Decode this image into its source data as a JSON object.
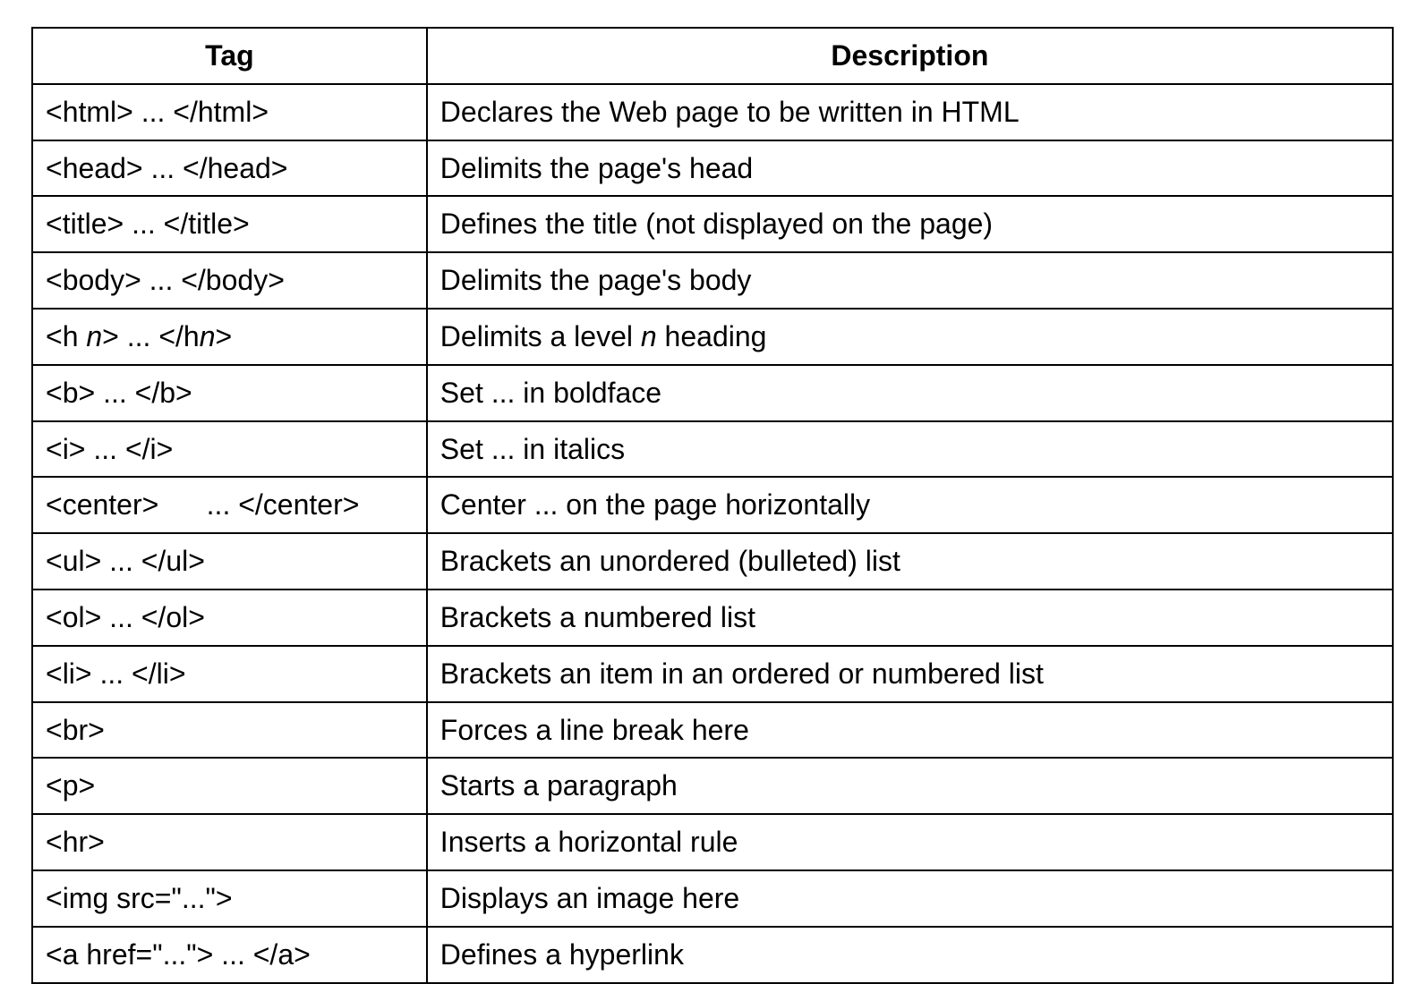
{
  "chart_data": {
    "type": "table",
    "columns": [
      "Tag",
      "Description"
    ],
    "rows": [
      {
        "tag": "<html> ... </html>",
        "desc": "Declares the Web page to be written in HTML"
      },
      {
        "tag": "<head> ... </head>",
        "desc": "Delimits the page's head"
      },
      {
        "tag": "<title> ... </title>",
        "desc": "Defines the title (not displayed on the page)"
      },
      {
        "tag": "<body> ... </body>",
        "desc": "Delimits the page's body"
      },
      {
        "tag_html": "&lt;h <span class=\"ital\">n</span>&gt; ... &lt;/h<span class=\"ital\">n</span>&gt;",
        "desc_html": "Delimits a level <span class=\"ital\">n</span> heading"
      },
      {
        "tag": "<b> ... </b>",
        "desc": "Set ... in boldface"
      },
      {
        "tag": "<i> ... </i>",
        "desc": "Set ... in italics"
      },
      {
        "tag_html": "&lt;center&gt;&nbsp;&nbsp;&nbsp;&nbsp;&nbsp;&nbsp;... &lt;/center&gt;",
        "desc": "Center ... on the page horizontally"
      },
      {
        "tag": "<ul> ... </ul>",
        "desc": "Brackets an unordered (bulleted) list"
      },
      {
        "tag": "<ol> ... </ol>",
        "desc": "Brackets a numbered list"
      },
      {
        "tag": "<li> ... </li>",
        "desc": "Brackets an item in an ordered or numbered list"
      },
      {
        "tag": "<br>",
        "desc": "Forces a line break here"
      },
      {
        "tag": "<p>",
        "desc": "Starts a paragraph"
      },
      {
        "tag": "<hr>",
        "desc": "Inserts a horizontal rule"
      },
      {
        "tag": "<img src=\"...\">",
        "desc": "Displays an image here"
      },
      {
        "tag": "<a href=\"...\"> ... </a>",
        "desc": "Defines a hyperlink"
      }
    ]
  }
}
